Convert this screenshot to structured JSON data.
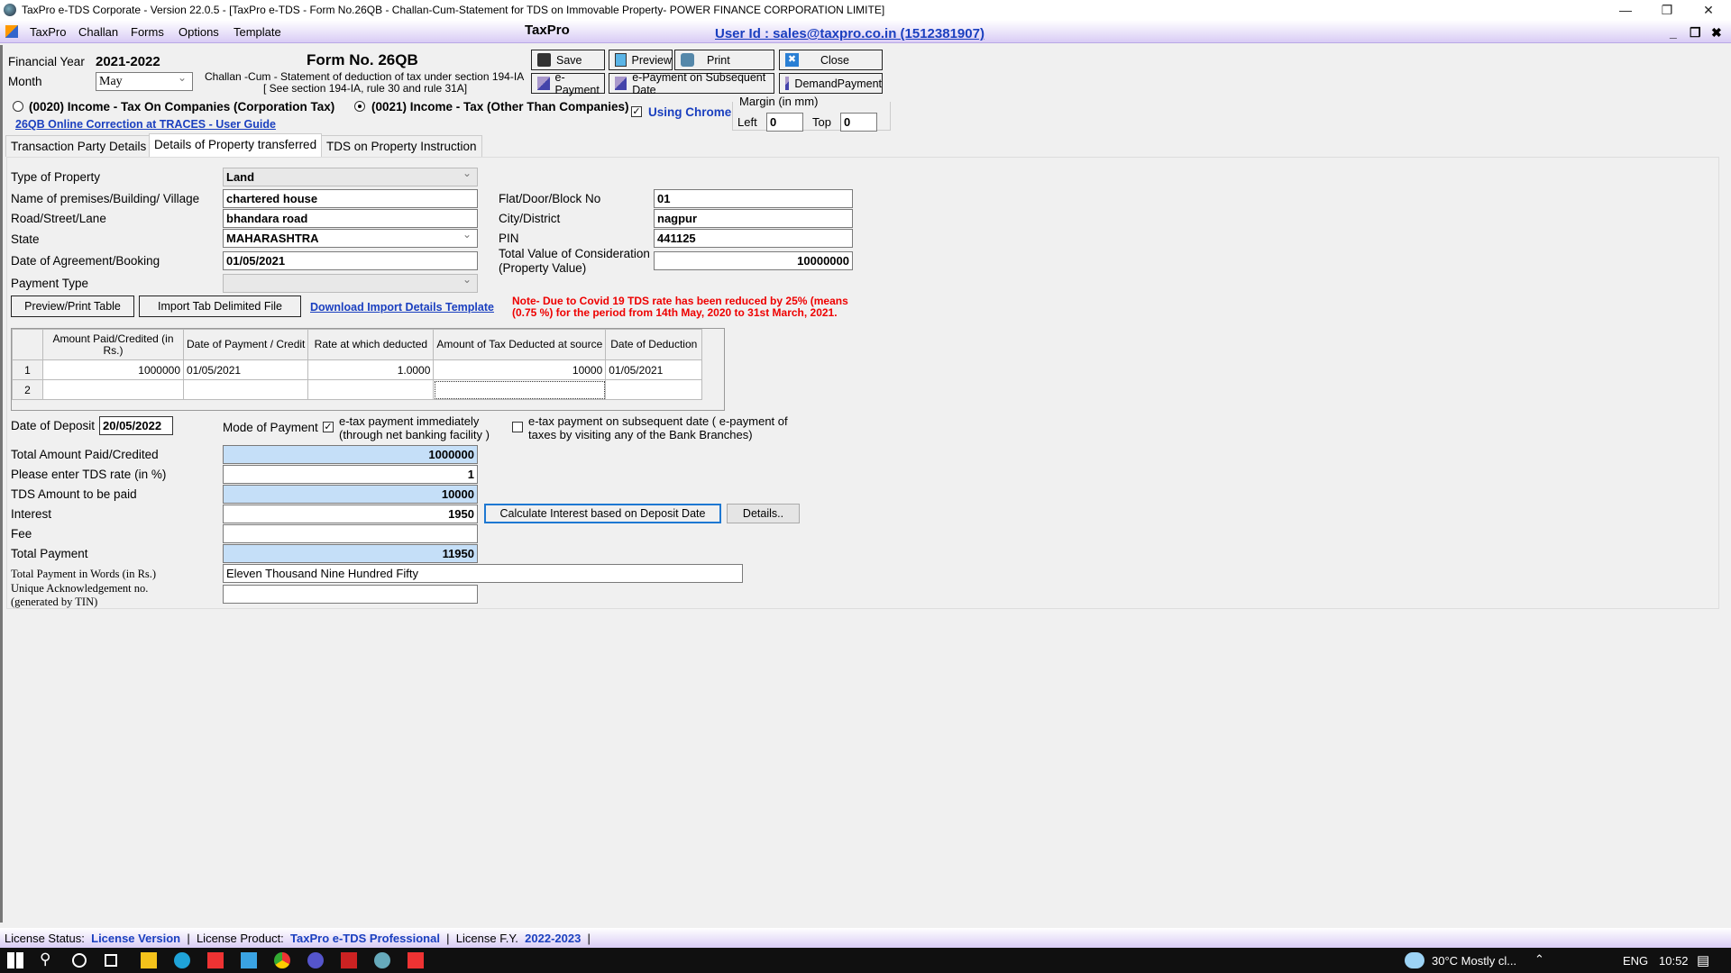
{
  "window": {
    "title": "TaxPro e-TDS Corporate - Version 22.0.5 - [TaxPro e-TDS - Form No.26QB - Challan-Cum-Statement for TDS on Immovable Property- POWER FINANCE CORPORATION LIMITE]",
    "controls": {
      "minimize": "—",
      "maximize": "❐",
      "close": "✕"
    }
  },
  "menubar": {
    "items": [
      "TaxPro",
      "Challan",
      "Forms",
      "Options",
      "Template"
    ],
    "center_title": "TaxPro",
    "user_id": "User Id : sales@taxpro.co.in (1512381907)",
    "mdi": {
      "minimize": "_",
      "restore": "❐",
      "close": "✖"
    }
  },
  "header": {
    "fy_label": "Financial Year",
    "fy_value": "2021-2022",
    "month_label": "Month",
    "month_value": "May",
    "form_title": "Form No. 26QB",
    "form_sub1": "Challan -Cum - Statement of deduction of tax under section 194-IA",
    "form_sub2": "[ See section 194-IA, rule 30 and rule 31A]",
    "radio1": "(0020) Income - Tax On Companies (Corporation Tax)",
    "radio2": "(0021) Income - Tax (Other Than Companies)",
    "radio_selected": "0021",
    "traces_link": "26QB Online Correction at  TRACES - User Guide",
    "using_chrome": "Using Chrome",
    "using_chrome_checked": true,
    "margin_label": "Margin (in mm)",
    "left_label": "Left",
    "left_value": "0",
    "top_label": "Top",
    "top_value": "0"
  },
  "toolbar": {
    "save": "Save",
    "preview": "Preview",
    "print": "Print",
    "close": "Close",
    "epayment": "e-Payment",
    "epayment_subsequent": "e-Payment on Subsequent Date",
    "demand_payment": "DemandPayment"
  },
  "tabs": [
    {
      "label": "Transaction Party Details",
      "active": false
    },
    {
      "label": "Details of Property transferred",
      "active": true
    },
    {
      "label": "TDS on Property Instruction",
      "active": false
    }
  ],
  "property": {
    "type_label": "Type of Property",
    "type_value": "Land",
    "premises_label": "Name of premises/Building/ Village",
    "premises_value": "chartered house",
    "road_label": "Road/Street/Lane",
    "road_value": "bhandara road",
    "state_label": "State",
    "state_value": "MAHARASHTRA",
    "agreement_label": "Date of Agreement/Booking",
    "agreement_value": "01/05/2021",
    "payment_type_label": "Payment Type",
    "payment_type_value": "",
    "flat_label": "Flat/Door/Block No",
    "flat_value": "01",
    "city_label": "City/District",
    "city_value": "nagpur",
    "pin_label": "PIN",
    "pin_value": "441125",
    "consideration_label1": "Total Value of Consideration",
    "consideration_label2": "(Property Value)",
    "consideration_value": "10000000"
  },
  "actions": {
    "preview_print": "Preview/Print Table",
    "import": "Import Tab Delimited File",
    "download_link": "Download Import Details Template",
    "note1": "Note- Due to Covid 19 TDS rate has been reduced by 25% (means",
    "note2": "(0.75 %) for the period from 14th  May, 2020  to 31st March, 2021."
  },
  "grid": {
    "columns": [
      "Amount Paid/Credited (in Rs.)",
      "Date of Payment / Credit",
      "Rate at which deducted",
      "Amount of Tax Deducted at source",
      "Date of Deduction"
    ],
    "rows": [
      {
        "n": "1",
        "cells": [
          "1000000",
          "01/05/2021",
          "1.0000",
          "10000",
          "01/05/2021"
        ]
      },
      {
        "n": "2",
        "cells": [
          "",
          "",
          "",
          "",
          ""
        ]
      }
    ]
  },
  "deposit": {
    "date_label": "Date of Deposit",
    "date_value": "20/05/2022",
    "mode_label": "Mode of Payment",
    "opt1_line1": "e-tax payment immediately",
    "opt1_line2": "(through net banking facility )",
    "opt1_checked": true,
    "opt2_line1": "e-tax payment on subsequent date ( e-payment of",
    "opt2_line2": "taxes by visiting any of the Bank  Branches)",
    "opt2_checked": false
  },
  "totals": {
    "total_amount_label": "Total Amount Paid/Credited",
    "total_amount": "1000000",
    "tds_rate_label": "Please enter TDS rate (in %)",
    "tds_rate": "1",
    "tds_amount_label": "TDS Amount to be paid",
    "tds_amount": "10000",
    "interest_label": "Interest",
    "interest": "1950",
    "calc_button": "Calculate Interest based on Deposit Date",
    "details_button": "Details..",
    "fee_label": "Fee",
    "fee": "",
    "total_payment_label": "Total Payment",
    "total_payment": "11950",
    "words_label": "Total Payment in Words (in Rs.)",
    "words": "Eleven Thousand Nine Hundred Fifty",
    "ack_label1": "Unique Acknowledgement no.",
    "ack_label2": "(generated by TIN)",
    "ack": ""
  },
  "status": {
    "license_status_label": "License Status:",
    "license_status": "License Version",
    "product_label": "License Product:",
    "product": "TaxPro e-TDS Professional",
    "fy_label": "License F.Y.",
    "fy": "2022-2023"
  },
  "taskbar": {
    "weather": "30°C  Mostly cl...",
    "lang": "ENG",
    "time": "10:52"
  }
}
